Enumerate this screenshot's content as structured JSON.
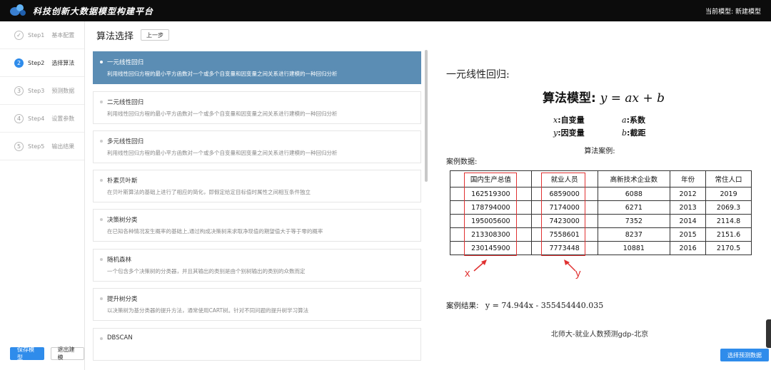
{
  "app": {
    "title": "科技创新大数据模型构建平台",
    "current_model": "当前模型: 新建模型"
  },
  "steps": [
    {
      "num": "✓",
      "name": "Step1",
      "label": "基本配置",
      "active": false
    },
    {
      "num": "2",
      "name": "Step2",
      "label": "选择算法",
      "active": true
    },
    {
      "num": "3",
      "name": "Step3",
      "label": "预测数据",
      "active": false
    },
    {
      "num": "4",
      "name": "Step4",
      "label": "设置参数",
      "active": false
    },
    {
      "num": "5",
      "name": "Step5",
      "label": "输出结果",
      "active": false
    }
  ],
  "sidebar": {
    "save_label": "保存模型",
    "exit_label": "退出建模"
  },
  "header": {
    "title": "算法选择",
    "back_label": "上一步"
  },
  "algorithms": [
    {
      "name": "一元线性回归",
      "desc": "利用线性回归方程的最小平方函数对一个或多个自变量和因变量之间关系进行建模的一种回归分析",
      "selected": true
    },
    {
      "name": "二元线性回归",
      "desc": "利用线性回归方程的最小平方函数对一个或多个自变量和因变量之间关系进行建模的一种回归分析",
      "selected": false
    },
    {
      "name": "多元线性回归",
      "desc": "利用线性回归方程的最小平方函数对一个或多个自变量和因变量之间关系进行建模的一种回归分析",
      "selected": false
    },
    {
      "name": "朴素贝叶斯",
      "desc": "在贝叶斯算法的基础上进行了相应的简化，即假定给定目标值时属性之间相互条件独立",
      "selected": false
    },
    {
      "name": "决策树分类",
      "desc": "在已知各种情况发生概率的基础上,通过构成决策树来求取净现值的期望值大于等于零的概率",
      "selected": false
    },
    {
      "name": "随机森林",
      "desc": "一个包含多个决策树的分类器，并且其输出的类别是由个别树输出的类别的众数而定",
      "selected": false
    },
    {
      "name": "提升树分类",
      "desc": "以决策树为基分类器的提升方法，通常使用CART树。针对不同问题的提升树学习算法",
      "selected": false
    },
    {
      "name": "DBSCAN",
      "desc": "",
      "selected": false
    }
  ],
  "detail": {
    "title": "一元线性回归:",
    "model_label": "算法模型:",
    "model_eq": "y = ax + b",
    "vars": [
      {
        "sym": "x",
        "label": ":自变量"
      },
      {
        "sym": "a",
        "label": ":系数"
      },
      {
        "sym": "y",
        "label": ":因变量"
      },
      {
        "sym": "b",
        "label": ":截距"
      }
    ],
    "case_title": "算法案例:",
    "case_data_label": "案例数据:",
    "table": {
      "headers": [
        "国内生产总值",
        "就业人员",
        "高新技术企业数",
        "年份",
        "常住人口"
      ],
      "rows": [
        [
          "162519300",
          "6859000",
          "6088",
          "2012",
          "2019"
        ],
        [
          "178794000",
          "7174000",
          "6271",
          "2013",
          "2069.3"
        ],
        [
          "195005600",
          "7423000",
          "7352",
          "2014",
          "2114.8"
        ],
        [
          "213308300",
          "7558601",
          "8237",
          "2015",
          "2151.6"
        ],
        [
          "230145900",
          "7773448",
          "10881",
          "2016",
          "2170.5"
        ]
      ]
    },
    "x_marker": "x",
    "y_marker": "y",
    "result_label": "案例结果:",
    "result_eq": "y = 74.944x - 355454440.035",
    "caption": "北师大-就业人数预测gdp-北京",
    "next_label": "选择预测数据"
  },
  "colors": {
    "accent": "#2f8ceb",
    "selected_row": "#5b8db4",
    "topbar": "#0c0c0c",
    "marker": "#e03131"
  }
}
